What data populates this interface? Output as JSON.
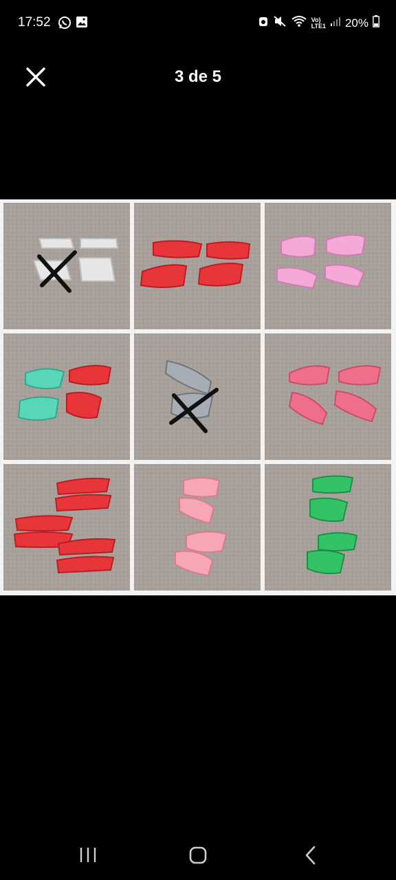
{
  "status_bar": {
    "time": "17:52",
    "battery": "20%",
    "network_badge_top": "Vo)",
    "network_badge_bottom": "LTE1",
    "left_icons": [
      "whatsapp-icon",
      "gallery-icon"
    ],
    "right_icons": [
      "alarm-icon",
      "mute-icon",
      "wifi-icon",
      "signal-icon",
      "battery-icon"
    ]
  },
  "viewer": {
    "counter": "3 de 5",
    "close_icon": "close-icon"
  },
  "photo": {
    "grid": "3x3",
    "crossed_out_cells": [
      1,
      5
    ]
  },
  "nav_bar": {
    "icons": [
      "recents-icon",
      "home-icon",
      "back-icon"
    ]
  }
}
